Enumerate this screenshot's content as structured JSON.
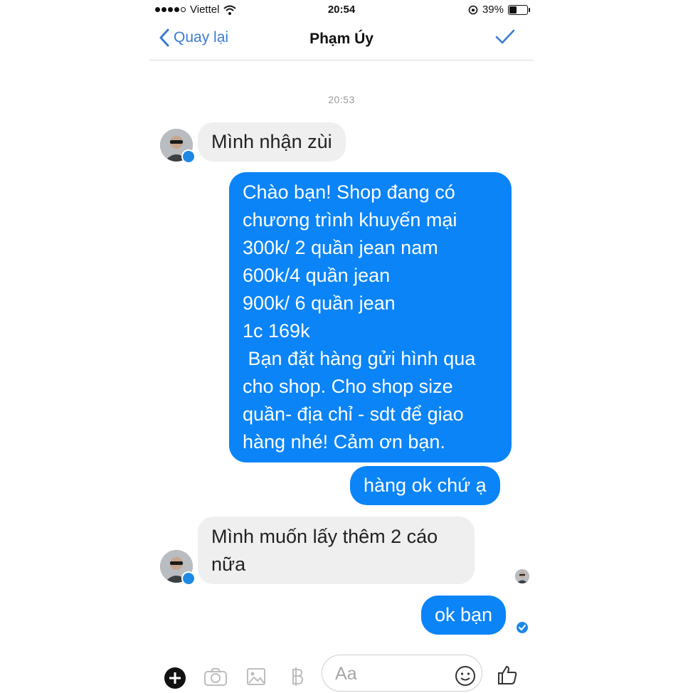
{
  "status": {
    "carrier": "Viettel",
    "time": "20:54",
    "battery": "39%",
    "battery_level": 0.39
  },
  "nav": {
    "back_label": "Quay lại",
    "title": "Phạm Úy"
  },
  "thread": {
    "timestamp": "20:53",
    "messages": [
      {
        "from": "contact",
        "text": "Mình nhận zùi"
      },
      {
        "from": "me",
        "lines": [
          "Chào bạn! Shop đang có",
          "chương trình khuyến mại",
          "300k/ 2 quần jean nam",
          "600k/4 quần jean",
          "900k/ 6 quần jean",
          "1c 169k",
          " Bạn đặt hàng gửi hình qua",
          "cho shop. Cho shop size",
          "quần- địa chỉ - sdt để giao",
          "hàng nhé! Cảm ơn bạn."
        ]
      },
      {
        "from": "me",
        "text": "hàng ok chứ ạ"
      },
      {
        "from": "contact",
        "lines": [
          "Mình muốn lấy thêm 2 cáo",
          "nữa"
        ]
      },
      {
        "from": "me",
        "text": "ok bạn"
      }
    ]
  },
  "composer": {
    "placeholder": "Aa",
    "icons": [
      "add-icon",
      "camera-icon",
      "image-icon",
      "currency-icon",
      "emoji-icon",
      "thumbs-up-icon"
    ]
  },
  "colors": {
    "accent": "#3a7bd5",
    "outgoing_bubble": "#0a84f7",
    "incoming_bubble": "#efefef"
  }
}
